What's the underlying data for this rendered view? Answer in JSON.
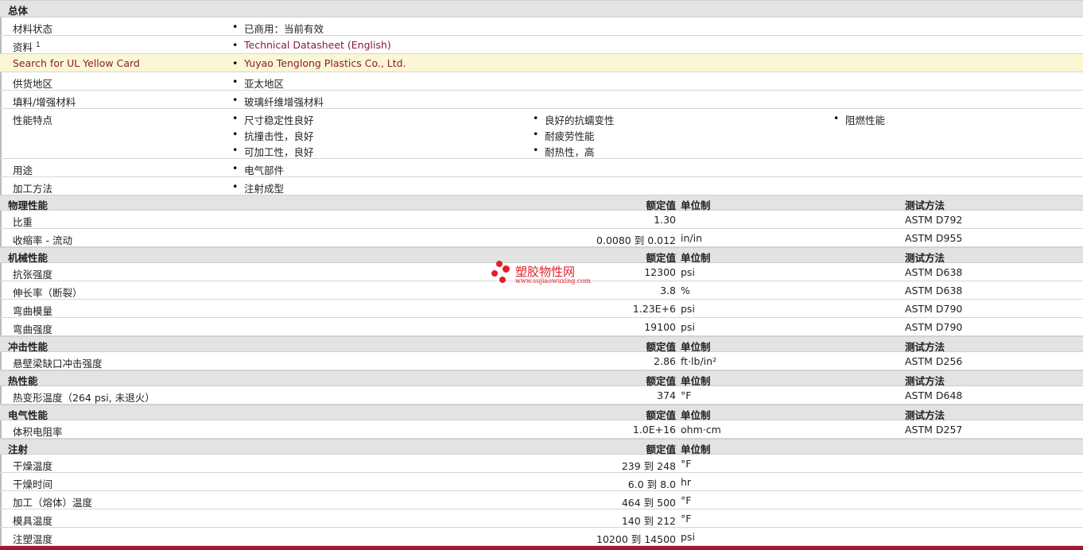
{
  "general": {
    "title": "总体",
    "rows": {
      "status": {
        "label": "材料状态",
        "value": "已商用：当前有效"
      },
      "docs": {
        "label": "资料",
        "sup": "1",
        "value": "Technical Datasheet (English)"
      },
      "ul": {
        "label": "Search for UL Yellow Card",
        "value": "Yuyao Tenglong Plastics Co., Ltd."
      },
      "region": {
        "label": "供货地区",
        "value": "亚太地区"
      },
      "filler": {
        "label": "填料/增强材料",
        "value": "玻璃纤维增强材料"
      },
      "features": {
        "label": "性能特点",
        "items": [
          "尺寸稳定性良好",
          "抗撞击性，良好",
          "可加工性，良好",
          "良好的抗蠕变性",
          "耐疲劳性能",
          "耐热性，高",
          "阻燃性能"
        ]
      },
      "uses": {
        "label": "用途",
        "value": "电气部件"
      },
      "process": {
        "label": "加工方法",
        "value": "注射成型"
      }
    }
  },
  "headers": {
    "value": "额定值",
    "unit": "单位制",
    "test": "测试方法"
  },
  "physical": {
    "title": "物理性能",
    "rows": [
      {
        "label": "比重",
        "value": "1.30",
        "unit": "",
        "test": "ASTM D792"
      },
      {
        "label": "收缩率  - 流动",
        "value": "0.0080 到  0.012",
        "unit": "in/in",
        "test": "ASTM D955"
      }
    ]
  },
  "mechanical": {
    "title": "机械性能",
    "rows": [
      {
        "label": "抗张强度",
        "value": "12300",
        "unit": "psi",
        "test": "ASTM D638"
      },
      {
        "label": "伸长率（断裂）",
        "value": "3.8",
        "unit": "%",
        "test": "ASTM D638"
      },
      {
        "label": "弯曲模量",
        "value": "1.23E+6",
        "unit": "psi",
        "test": "ASTM D790"
      },
      {
        "label": "弯曲强度",
        "value": "19100",
        "unit": "psi",
        "test": "ASTM D790"
      }
    ]
  },
  "impact": {
    "title": "冲击性能",
    "rows": [
      {
        "label": "悬壁梁缺口冲击强度",
        "value": "2.86",
        "unit": "ft·lb/in²",
        "test": "ASTM D256"
      }
    ]
  },
  "thermal": {
    "title": "热性能",
    "rows": [
      {
        "label": "热变形温度（264 psi, 未退火）",
        "value": "374",
        "unit": "°F",
        "test": "ASTM D648"
      }
    ]
  },
  "electrical": {
    "title": "电气性能",
    "rows": [
      {
        "label": "体积电阻率",
        "value": "1.0E+16",
        "unit": "ohm·cm",
        "test": "ASTM D257"
      }
    ]
  },
  "injection": {
    "title": "注射",
    "rows": [
      {
        "label": "干燥温度",
        "value": "239 到  248",
        "unit": "°F"
      },
      {
        "label": "干燥时间",
        "value": "6.0 到  8.0",
        "unit": "hr"
      },
      {
        "label": "加工（熔体）温度",
        "value": "464 到  500",
        "unit": "°F"
      },
      {
        "label": "模具温度",
        "value": "140 到  212",
        "unit": "°F"
      },
      {
        "label": "注塑温度",
        "value": "10200 到  14500",
        "unit": "psi"
      }
    ]
  },
  "watermark": {
    "name": "塑胶物性网",
    "url": "www.sujiaowuxing.com",
    "color": "#e1202a"
  },
  "colors": {
    "section_bg": "#e3e3e3",
    "highlight_bg": "#fbf7d5",
    "link": "#8a1a3a",
    "footer": "#a3182e"
  }
}
